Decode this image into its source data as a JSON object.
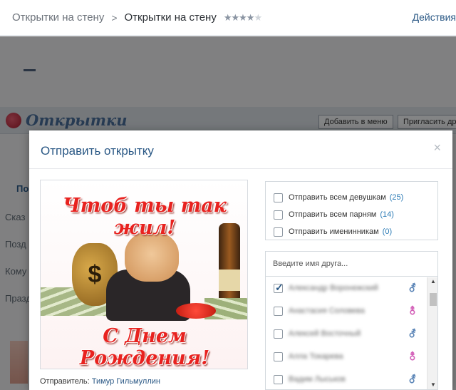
{
  "topbar": {
    "crumb_parent": "Открытки на стену",
    "separator": ">",
    "crumb_current": "Открытки на стену",
    "rating_stars_filled": "★★★★",
    "rating_stars_empty": "★",
    "rating_value": 4,
    "actions_link": "Действия"
  },
  "background_app": {
    "logo_text": "Открытки",
    "add_to_menu_button": "Добавить в меню",
    "invite_button": "Пригласить дру",
    "tab_label": "По",
    "side_items": [
      "Сказ",
      "Позд",
      "Кому",
      "Празд"
    ]
  },
  "modal": {
    "title": "Отправить открытку",
    "close_glyph": "×",
    "card": {
      "top_text": "Чтоб ты так жил!",
      "bottom_text": "С Днем Рождения!",
      "bag_symbol": "$"
    },
    "sender_label": "Отправитель:",
    "sender_name": "Тимур Гильмуллин",
    "options": [
      {
        "label": "Отправить всем девушкам",
        "count": "(25)"
      },
      {
        "label": "Отправить всем парням",
        "count": "(14)"
      },
      {
        "label": "Отправить именинникам",
        "count": "(0)"
      }
    ],
    "search_placeholder": "Введите имя друга...",
    "friends": [
      {
        "name": "Александр Воронежский",
        "checked": true,
        "gender_glyph": "⚦"
      },
      {
        "name": "Анастасия Соловева",
        "checked": false,
        "gender_glyph": "⚨"
      },
      {
        "name": "Алексей Восточный",
        "checked": false,
        "gender_glyph": "⚦"
      },
      {
        "name": "Алла Токарева",
        "checked": false,
        "gender_glyph": "⚨"
      },
      {
        "name": "Вадим Лыськов",
        "checked": false,
        "gender_glyph": "⚦"
      }
    ],
    "scroll_up": "▲",
    "scroll_down": "▼"
  },
  "colors": {
    "accent": "#2a5885",
    "count": "#2a7ab5",
    "male": "#5b85b7",
    "female": "#d360b8",
    "card_text": "#e8221f"
  }
}
